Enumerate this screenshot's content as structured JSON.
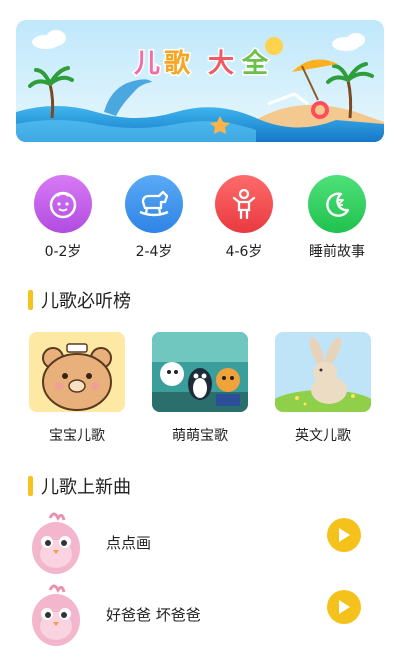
{
  "banner": {
    "title_chars": [
      "儿",
      "歌",
      "大",
      "全"
    ]
  },
  "categories": [
    {
      "label": "0-2岁",
      "color": "#c45be8",
      "icon": "baby-face-icon"
    },
    {
      "label": "2-4岁",
      "color": "#3b95f0",
      "icon": "rocking-horse-icon"
    },
    {
      "label": "4-6岁",
      "color": "#f0494c",
      "icon": "child-figure-icon"
    },
    {
      "label": "睡前故事",
      "color": "#2fd45c",
      "icon": "moon-sleep-icon"
    }
  ],
  "section_hits": {
    "title": "儿歌必听榜"
  },
  "cards": [
    {
      "label": "宝宝儿歌"
    },
    {
      "label": "萌萌宝歌"
    },
    {
      "label": "英文儿歌"
    }
  ],
  "section_new": {
    "title": "儿歌上新曲"
  },
  "songs": [
    {
      "title": "点点画"
    },
    {
      "title": "好爸爸 坏爸爸"
    }
  ],
  "colors": {
    "accent": "#f6c21e",
    "play": "#f5c21c"
  }
}
